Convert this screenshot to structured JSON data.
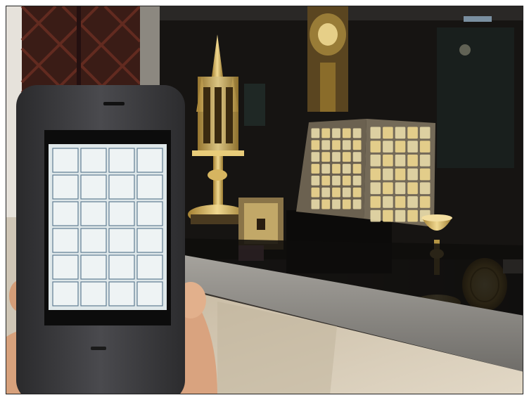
{
  "scene": {
    "subject": "phone-camera-view-of-museum-display-case",
    "colors": {
      "wall_dark": "#2a2622",
      "glass_dark": "#141210",
      "gold": "#c9a85a",
      "gold_light": "#f0d890",
      "ledge_metal": "#8d8b86",
      "stone": "#d3c8b3",
      "phone_body": "#3a3a3c",
      "phone_screen": "#e4ecee",
      "skin": "#d9a37f"
    },
    "phone_screen_grid": {
      "columns": 4,
      "rows": 6
    },
    "book_cover_grid": {
      "columns": 5,
      "rows": 7
    }
  }
}
